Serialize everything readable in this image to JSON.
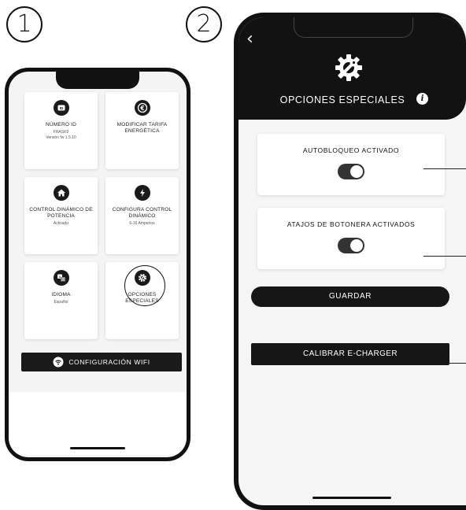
{
  "steps": {
    "one": "1",
    "two": "2"
  },
  "phone1": {
    "tiles": [
      {
        "title": "NÚMERO ID",
        "sub1": "FRASK9",
        "sub2": "Versión fw 1.5.10",
        "icon": "id-icon"
      },
      {
        "title": "MODIFICAR TARIFA ENERGÉTICA",
        "sub1": "",
        "sub2": "",
        "icon": "euro-icon"
      },
      {
        "title": "CONTROL DINÁMICO DE POTENCIA",
        "sub1": "Activado",
        "sub2": "",
        "icon": "home-icon"
      },
      {
        "title": "CONFIGURA CONTROL DINÁMICO",
        "sub1": "6-16 Amperios",
        "sub2": "",
        "icon": "bolt-icon"
      },
      {
        "title": "IDIOMA",
        "sub1": "Español",
        "sub2": "",
        "icon": "translate-icon"
      },
      {
        "title": "OPCIONES ESPECIALES",
        "sub1": "",
        "sub2": "",
        "icon": "gear-wrench-icon"
      }
    ],
    "wifi_button": "CONFIGURACIÓN WIFI"
  },
  "phone2": {
    "back": "‹",
    "title": "OPCIONES ESPECIALES",
    "info": "i",
    "options": [
      {
        "label": "AUTOBLOQUEO ACTIVADO",
        "state": "on"
      },
      {
        "label": "ATAJOS DE BOTONERA ACTIVADOS",
        "state": "on"
      }
    ],
    "save_button": "GUARDAR",
    "calibrate_button": "CALIBRAR E-CHARGER"
  },
  "colors": {
    "dark": "#121212",
    "screen_bg": "#f6f6f6",
    "card": "#ffffff"
  }
}
